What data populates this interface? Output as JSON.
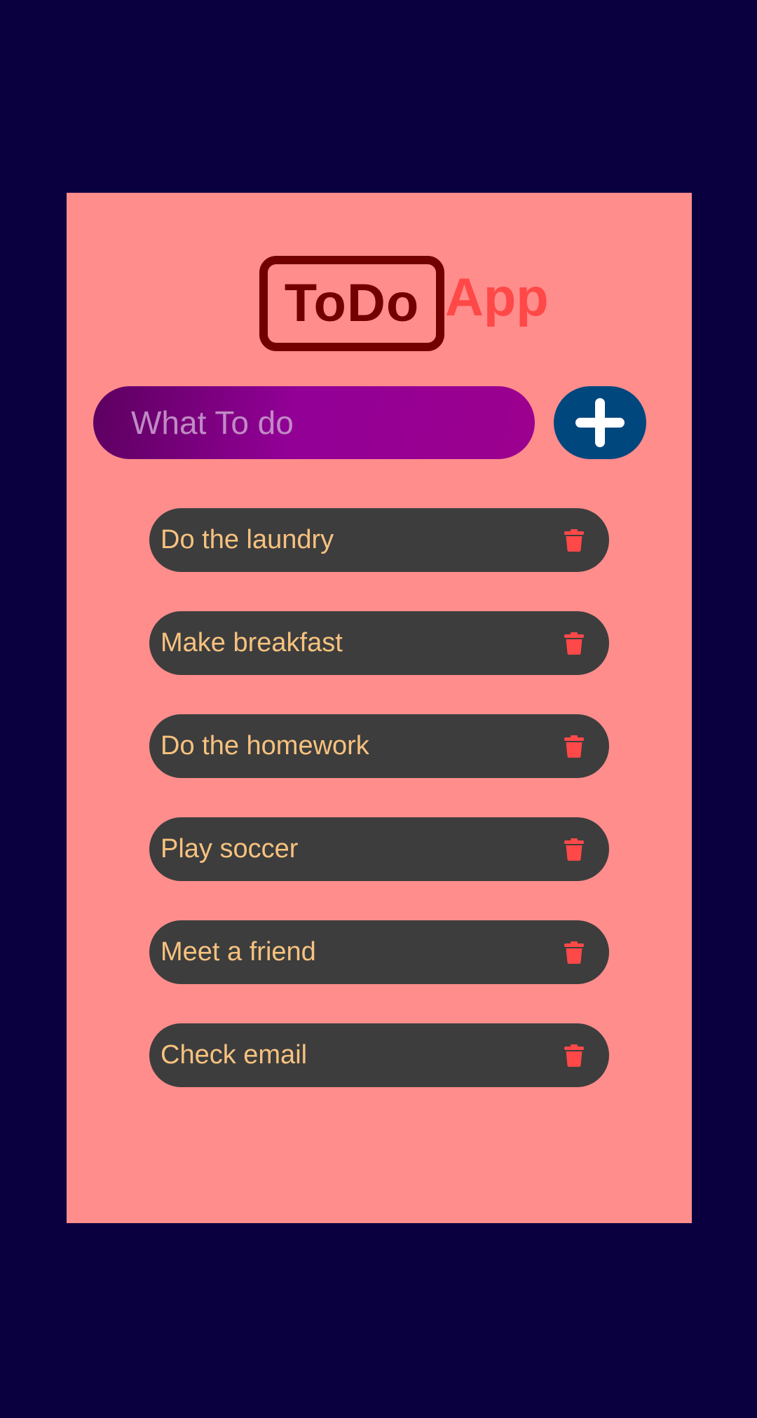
{
  "app": {
    "title_todo": "ToDo",
    "title_app": "App"
  },
  "input": {
    "placeholder": "What To do",
    "value": ""
  },
  "add_button": {
    "icon": "plus-icon"
  },
  "todos": [
    {
      "label": "Do the laundry"
    },
    {
      "label": "Make breakfast"
    },
    {
      "label": "Do the homework"
    },
    {
      "label": "Play soccer"
    },
    {
      "label": "Meet a friend"
    },
    {
      "label": "Check email"
    }
  ],
  "delete_icon": "trash-icon",
  "colors": {
    "background": "#0a0040",
    "card": "#ff8d8c",
    "title_dark": "#720000",
    "title_accent": "#ff4848",
    "input_gradient_start": "#5c0060",
    "input_gradient_end": "#9c008e",
    "add_button": "#00477e",
    "item_background": "#3d3d3d",
    "item_text": "#f7c27f",
    "trash_icon": "#ff4848"
  }
}
